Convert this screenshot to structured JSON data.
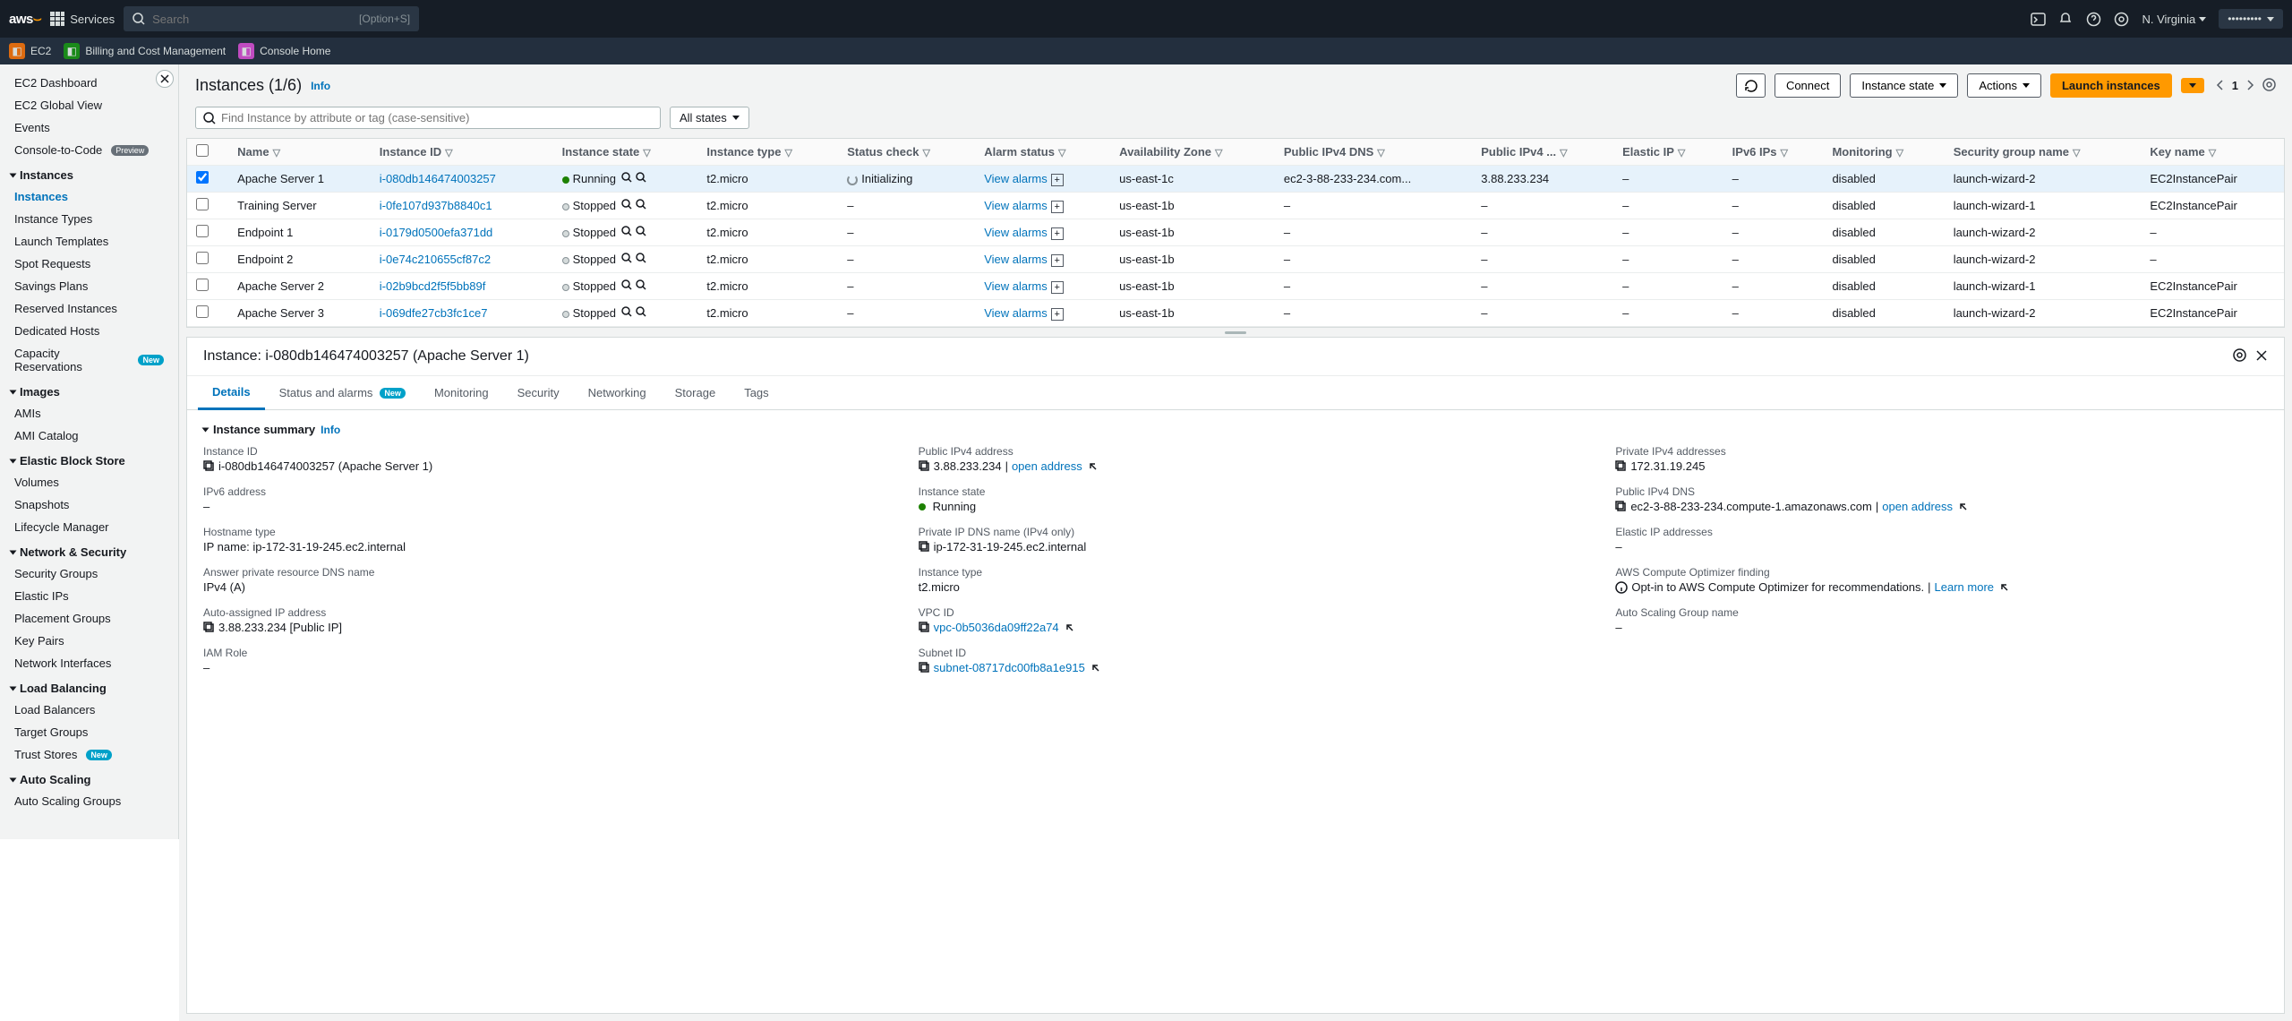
{
  "topbar": {
    "logo": "aws",
    "services": "Services",
    "search_placeholder": "Search",
    "search_hint": "[Option+S]",
    "region": "N. Virginia"
  },
  "svcstrip": {
    "ec2": "EC2",
    "billing": "Billing and Cost Management",
    "console_home": "Console Home"
  },
  "sidebar": {
    "items": [
      {
        "label": "EC2 Dashboard"
      },
      {
        "label": "EC2 Global View"
      },
      {
        "label": "Events"
      },
      {
        "label": "Console-to-Code",
        "badge": "Preview"
      }
    ],
    "sections": [
      {
        "head": "Instances",
        "items": [
          {
            "label": "Instances",
            "sel": true
          },
          {
            "label": "Instance Types"
          },
          {
            "label": "Launch Templates"
          },
          {
            "label": "Spot Requests"
          },
          {
            "label": "Savings Plans"
          },
          {
            "label": "Reserved Instances"
          },
          {
            "label": "Dedicated Hosts"
          },
          {
            "label": "Capacity Reservations",
            "badge": "New"
          }
        ]
      },
      {
        "head": "Images",
        "items": [
          {
            "label": "AMIs"
          },
          {
            "label": "AMI Catalog"
          }
        ]
      },
      {
        "head": "Elastic Block Store",
        "items": [
          {
            "label": "Volumes"
          },
          {
            "label": "Snapshots"
          },
          {
            "label": "Lifecycle Manager"
          }
        ]
      },
      {
        "head": "Network & Security",
        "items": [
          {
            "label": "Security Groups"
          },
          {
            "label": "Elastic IPs"
          },
          {
            "label": "Placement Groups"
          },
          {
            "label": "Key Pairs"
          },
          {
            "label": "Network Interfaces"
          }
        ]
      },
      {
        "head": "Load Balancing",
        "items": [
          {
            "label": "Load Balancers"
          },
          {
            "label": "Target Groups"
          },
          {
            "label": "Trust Stores",
            "badge": "New"
          }
        ]
      },
      {
        "head": "Auto Scaling",
        "items": [
          {
            "label": "Auto Scaling Groups"
          }
        ]
      }
    ]
  },
  "page": {
    "title": "Instances (1/6)",
    "info": "Info",
    "connect": "Connect",
    "instance_state": "Instance state",
    "actions": "Actions",
    "launch": "Launch instances",
    "page_num": "1",
    "find_placeholder": "Find Instance by attribute or tag (case-sensitive)",
    "all_states": "All states"
  },
  "columns": [
    "",
    "Name",
    "Instance ID",
    "Instance state",
    "Instance type",
    "Status check",
    "Alarm status",
    "Availability Zone",
    "Public IPv4 DNS",
    "Public IPv4 ...",
    "Elastic IP",
    "IPv6 IPs",
    "Monitoring",
    "Security group name",
    "Key name"
  ],
  "rows": [
    {
      "sel": true,
      "name": "Apache Server 1",
      "iid": "i-080db146474003257",
      "state": "Running",
      "stateKind": "running",
      "itype": "t2.micro",
      "check": "Initializing",
      "checkKind": "init",
      "alarm": "View alarms",
      "az": "us-east-1c",
      "dns": "ec2-3-88-233-234.com...",
      "ip": "3.88.233.234",
      "eip": "–",
      "ipv6": "–",
      "mon": "disabled",
      "sg": "launch-wizard-2",
      "key": "EC2InstancePair"
    },
    {
      "sel": false,
      "name": "Training Server",
      "iid": "i-0fe107d937b8840c1",
      "state": "Stopped",
      "stateKind": "stopped",
      "itype": "t2.micro",
      "check": "–",
      "alarm": "View alarms",
      "az": "us-east-1b",
      "dns": "–",
      "ip": "–",
      "eip": "–",
      "ipv6": "–",
      "mon": "disabled",
      "sg": "launch-wizard-1",
      "key": "EC2InstancePair"
    },
    {
      "sel": false,
      "name": "Endpoint 1",
      "iid": "i-0179d0500efa371dd",
      "state": "Stopped",
      "stateKind": "stopped",
      "itype": "t2.micro",
      "check": "–",
      "alarm": "View alarms",
      "az": "us-east-1b",
      "dns": "–",
      "ip": "–",
      "eip": "–",
      "ipv6": "–",
      "mon": "disabled",
      "sg": "launch-wizard-2",
      "key": "–"
    },
    {
      "sel": false,
      "name": "Endpoint 2",
      "iid": "i-0e74c210655cf87c2",
      "state": "Stopped",
      "stateKind": "stopped",
      "itype": "t2.micro",
      "check": "–",
      "alarm": "View alarms",
      "az": "us-east-1b",
      "dns": "–",
      "ip": "–",
      "eip": "–",
      "ipv6": "–",
      "mon": "disabled",
      "sg": "launch-wizard-2",
      "key": "–"
    },
    {
      "sel": false,
      "name": "Apache Server 2",
      "iid": "i-02b9bcd2f5f5bb89f",
      "state": "Stopped",
      "stateKind": "stopped",
      "itype": "t2.micro",
      "check": "–",
      "alarm": "View alarms",
      "az": "us-east-1b",
      "dns": "–",
      "ip": "–",
      "eip": "–",
      "ipv6": "–",
      "mon": "disabled",
      "sg": "launch-wizard-1",
      "key": "EC2InstancePair"
    },
    {
      "sel": false,
      "name": "Apache Server 3",
      "iid": "i-069dfe27cb3fc1ce7",
      "state": "Stopped",
      "stateKind": "stopped",
      "itype": "t2.micro",
      "check": "–",
      "alarm": "View alarms",
      "az": "us-east-1b",
      "dns": "–",
      "ip": "–",
      "eip": "–",
      "ipv6": "–",
      "mon": "disabled",
      "sg": "launch-wizard-2",
      "key": "EC2InstancePair"
    }
  ],
  "detail": {
    "title": "Instance: i-080db146474003257 (Apache Server 1)",
    "tabs": [
      "Details",
      "Status and alarms",
      "Monitoring",
      "Security",
      "Networking",
      "Storage",
      "Tags"
    ],
    "tabs_active": 0,
    "summary_title": "Instance summary",
    "info": "Info",
    "fields": {
      "c1": [
        {
          "label": "Instance ID",
          "value": "i-080db146474003257 (Apache Server 1)",
          "copy": true
        },
        {
          "label": "IPv6 address",
          "value": "–"
        },
        {
          "label": "Hostname type",
          "value": "IP name: ip-172-31-19-245.ec2.internal"
        },
        {
          "label": "Answer private resource DNS name",
          "value": "IPv4 (A)"
        },
        {
          "label": "Auto-assigned IP address",
          "value": "3.88.233.234 [Public IP]",
          "copy": true
        },
        {
          "label": "IAM Role",
          "value": "–"
        }
      ],
      "c2": [
        {
          "label": "Public IPv4 address",
          "value": "3.88.233.234",
          "copy": true,
          "open": "open address"
        },
        {
          "label": "Instance state",
          "value": "Running",
          "running": true
        },
        {
          "label": "Private IP DNS name (IPv4 only)",
          "value": "ip-172-31-19-245.ec2.internal",
          "copy": true
        },
        {
          "label": "Instance type",
          "value": "t2.micro"
        },
        {
          "label": "VPC ID",
          "value": "vpc-0b5036da09ff22a74",
          "copy": true,
          "link": true,
          "ext": true
        },
        {
          "label": "Subnet ID",
          "value": "subnet-08717dc00fb8a1e915",
          "copy": true,
          "link": true,
          "ext": true
        }
      ],
      "c3": [
        {
          "label": "Private IPv4 addresses",
          "value": "172.31.19.245",
          "copy": true
        },
        {
          "label": "Public IPv4 DNS",
          "value": "ec2-3-88-233-234.compute-1.amazonaws.com",
          "copy": true,
          "open": "open address"
        },
        {
          "label": "Elastic IP addresses",
          "value": "–"
        },
        {
          "label": "AWS Compute Optimizer finding",
          "value": "Opt-in to AWS Compute Optimizer for recommendations.",
          "info": true,
          "learn": "Learn more"
        },
        {
          "label": "Auto Scaling Group name",
          "value": "–"
        }
      ]
    }
  }
}
